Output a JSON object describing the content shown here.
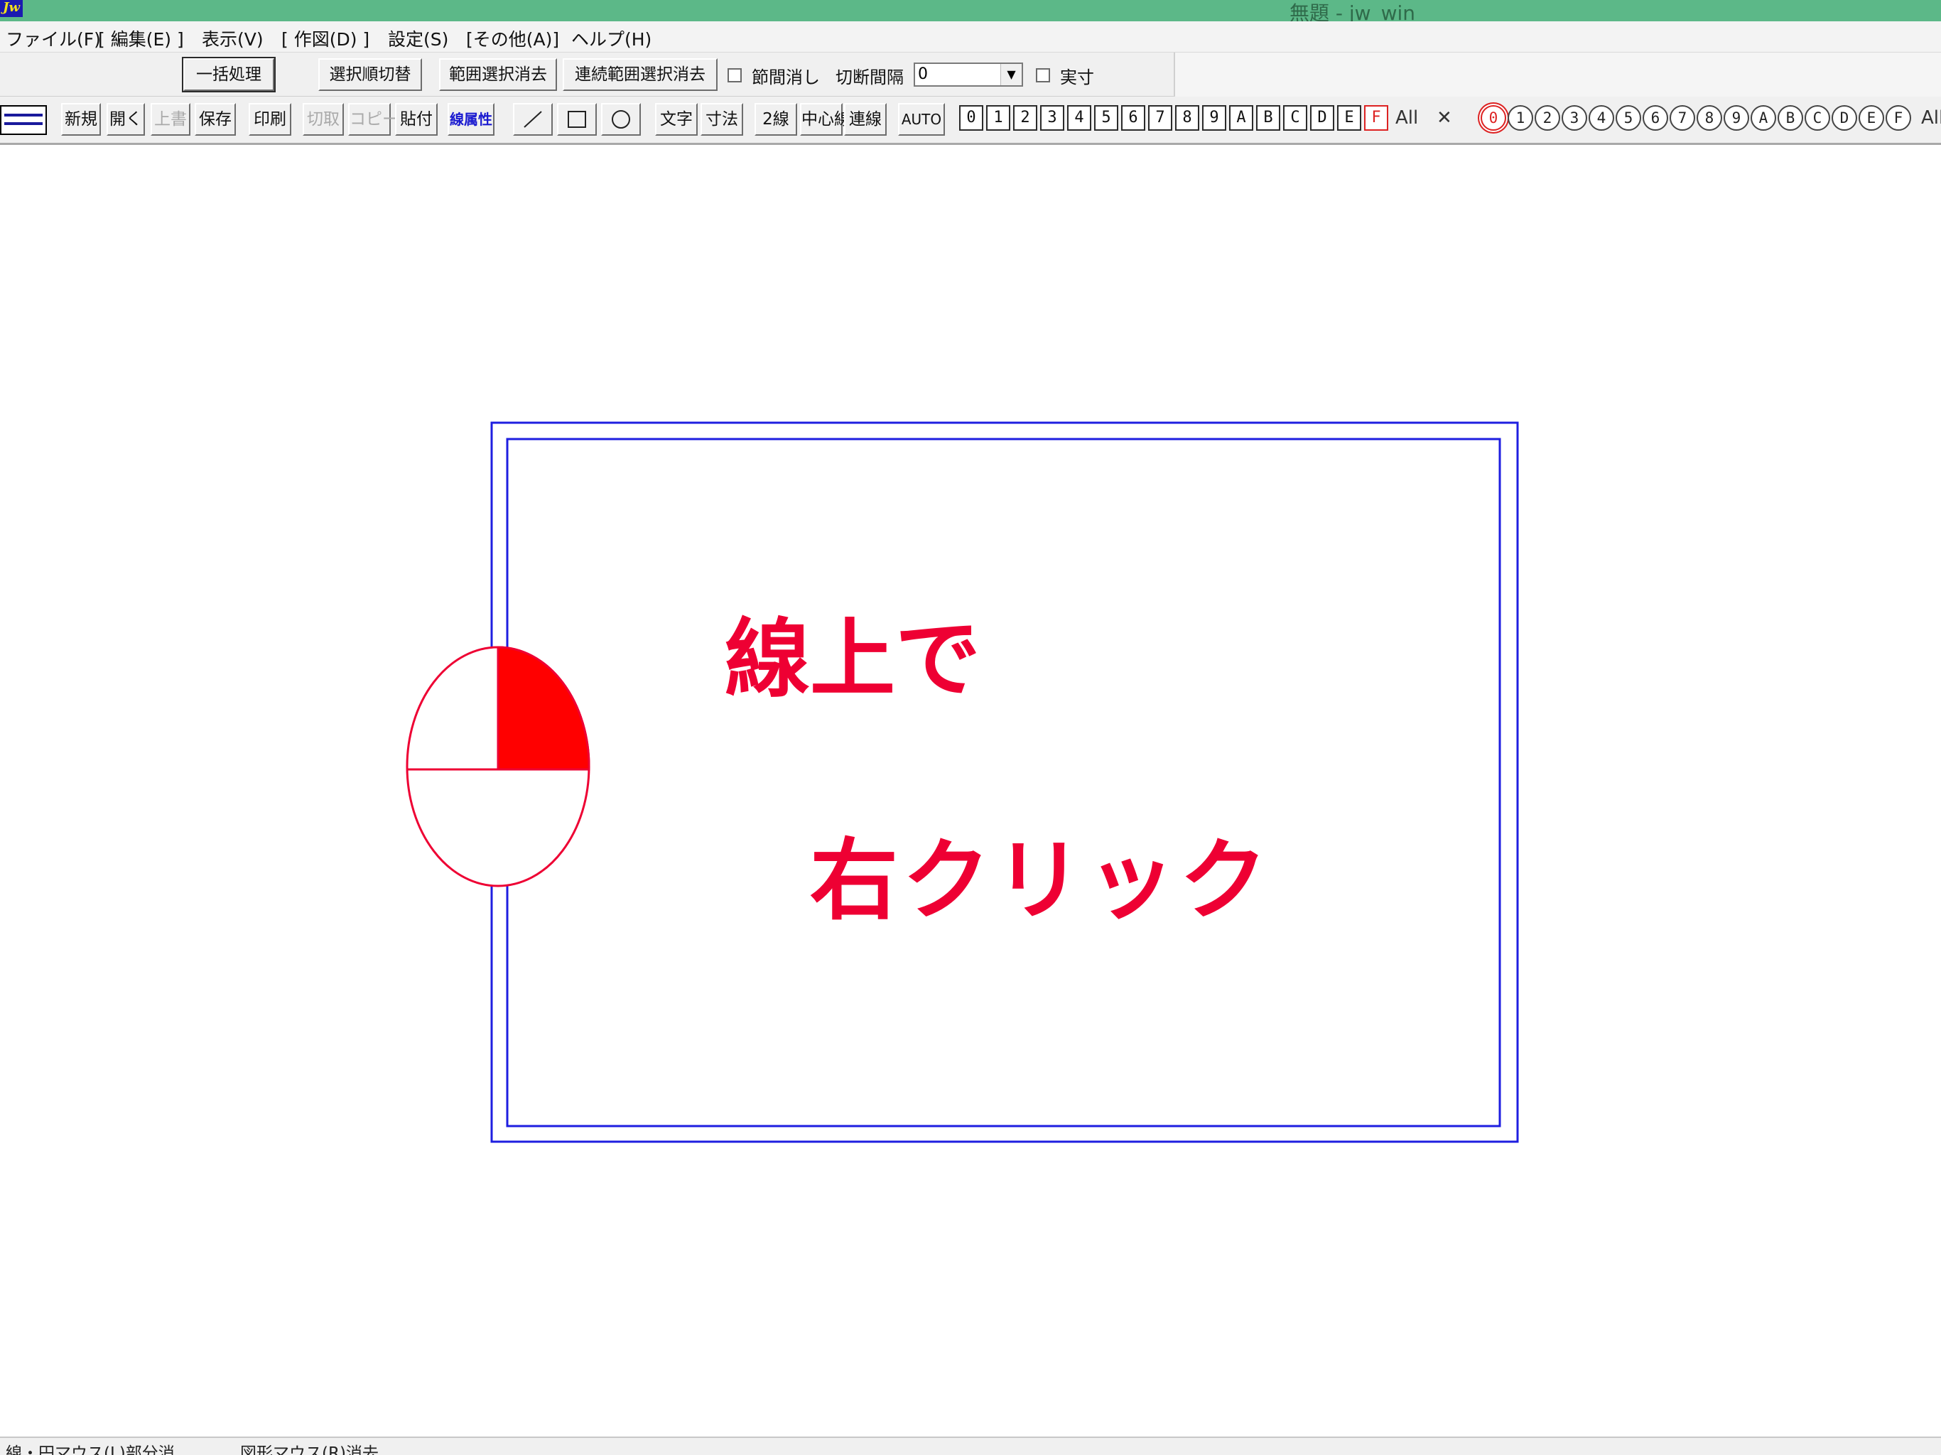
{
  "window": {
    "title": "無題 - jw_win",
    "app_icon": "jw-logo-icon"
  },
  "menu": [
    {
      "label": "ファイル(F)"
    },
    {
      "label": "[ 編集(E) ]"
    },
    {
      "label": "表示(V)"
    },
    {
      "label": "[ 作図(D) ]"
    },
    {
      "label": "設定(S)"
    },
    {
      "label": "[その他(A)]"
    },
    {
      "label": "ヘルプ(H)"
    }
  ],
  "toolbar1": {
    "batch": "一括処理",
    "select_order": "選択順切替",
    "range_clear": "範囲選択消去",
    "continuous_clear": "連続範囲選択消去",
    "node_erase": "節間消し",
    "cut_interval": "切断間隔",
    "cut_interval_value": "0",
    "actual_size": "実寸"
  },
  "toolbar2": {
    "new": "新規",
    "open": "開く",
    "overwrite": "上書",
    "save": "保存",
    "print": "印刷",
    "cut": "切取",
    "copy": "コピー",
    "paste": "貼付",
    "line_attr": "線属性",
    "line_tool": "line-tool-icon",
    "rect_tool": "rectangle-tool-icon",
    "circle_tool": "circle-tool-icon",
    "text": "文字",
    "dimension": "寸法",
    "double_line": "2線",
    "center_line": "中心線",
    "connect_line": "連線",
    "auto": "AUTO"
  },
  "layers": [
    "0",
    "1",
    "2",
    "3",
    "4",
    "5",
    "6",
    "7",
    "8",
    "9",
    "A",
    "B",
    "C",
    "D",
    "E",
    "F"
  ],
  "layer_all": "All",
  "groups": [
    "0",
    "1",
    "2",
    "3",
    "4",
    "5",
    "6",
    "7",
    "8",
    "9",
    "A",
    "B",
    "C",
    "D",
    "E",
    "F"
  ],
  "group_all": "All",
  "annotation": {
    "line1": "線上で",
    "line2": "右クリック"
  },
  "colors": {
    "accent_red": "#ee0033",
    "frame_blue": "#1e1ee0",
    "titlebar_green": "#5cb888"
  },
  "status": {
    "left": "線・円マウス(L)部分消",
    "right": "図形マウス(R)消去"
  }
}
